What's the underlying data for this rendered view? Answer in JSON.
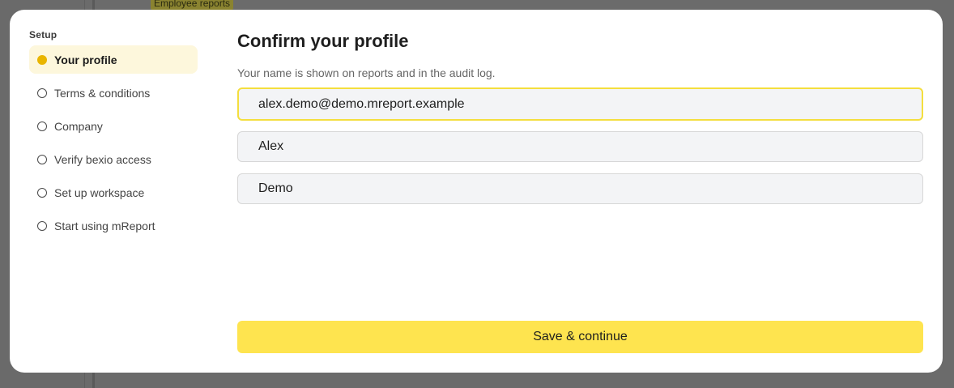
{
  "background": {
    "tag_label": "Employee reports"
  },
  "sidebar": {
    "heading": "Setup",
    "steps": [
      {
        "label": "Your profile",
        "active": true
      },
      {
        "label": "Terms & conditions",
        "active": false
      },
      {
        "label": "Company",
        "active": false
      },
      {
        "label": "Verify bexio access",
        "active": false
      },
      {
        "label": "Set up workspace",
        "active": false
      },
      {
        "label": "Start using mReport",
        "active": false
      }
    ]
  },
  "main": {
    "title": "Confirm your profile",
    "subtitle": "Your name is shown on reports and in the audit log.",
    "fields": {
      "email": {
        "value": "alex.demo@demo.mreport.example"
      },
      "first_name": {
        "value": "Alex"
      },
      "last_name": {
        "value": "Demo"
      }
    },
    "save_label": "Save & continue"
  },
  "colors": {
    "accent": "#fee44f",
    "active_dot": "#e9b500",
    "active_step_bg": "#fdf7dc",
    "focus_border": "#f4de3e"
  }
}
